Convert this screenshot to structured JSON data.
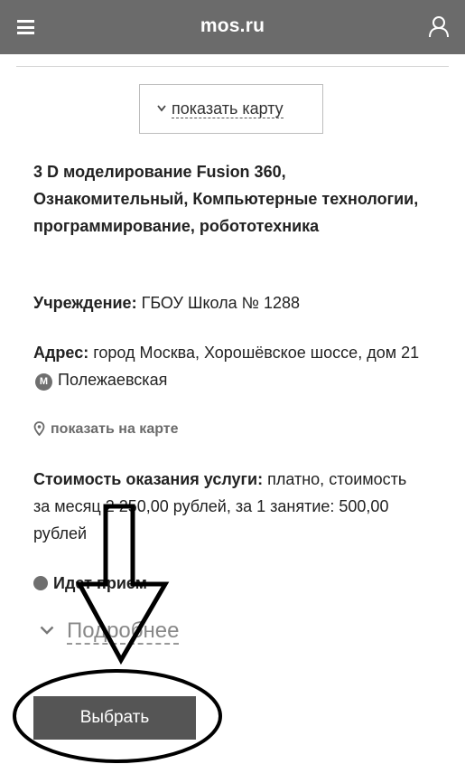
{
  "header": {
    "brand": "mos.ru",
    "menu_icon": "hamburger-menu-icon",
    "user_icon": "user-icon"
  },
  "map_toggle": {
    "label": "показать карту",
    "icon": "chevron-down-icon"
  },
  "course": {
    "title": "3 D моделирование Fusion 360, Ознакомительный, Компьютерные технологии, программирование, робототехника"
  },
  "institution": {
    "label": "Учреждение:",
    "value": "ГБОУ Школа № 1288"
  },
  "address": {
    "label": "Адрес:",
    "value": "город Москва, Хорошёвское шоссе, дом 21",
    "metro_badge": "М",
    "metro_station": "Полежаевская"
  },
  "show_on_map": {
    "label": "показать на карте",
    "icon": "map-pin-icon"
  },
  "cost": {
    "label": "Стоимость оказания услуги:",
    "value": "платно, стоимость за месяц 2 250,00 рублей, за 1 занятие: 500,00 рублей"
  },
  "status": {
    "label": "Идет прием"
  },
  "more": {
    "label": "Подробнее",
    "icon": "chevron-down-icon"
  },
  "actions": {
    "select_label": "Выбрать"
  },
  "colors": {
    "header_bg": "#6b6b6b",
    "button_bg": "#555555",
    "annotation": "#000000"
  }
}
